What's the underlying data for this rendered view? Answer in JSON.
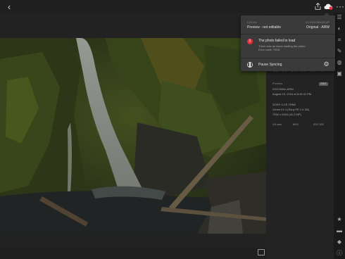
{
  "topbar": {
    "back_icon": "chevron-left-icon",
    "share_icon": "share-icon",
    "cloud_icon": "cloud-sync-icon",
    "more_icon": "more-icon"
  },
  "popover": {
    "local_caption": "LOCAL",
    "local_value": "Preview - not editable",
    "cloud_caption": "CLOUD BACKUP",
    "cloud_value": "Original - ARW",
    "error_title": "The photo failed to load",
    "error_body_line1": "There was an issue loading the photo.",
    "error_body_line2": "Error code: 7005.",
    "pause_label": "Pause Syncing",
    "colors": {
      "error": "#e0343c",
      "background": "#3a3a3a"
    }
  },
  "info": {
    "rating": 0,
    "rating_max": 5,
    "preview_label": "Preview",
    "edit_badge": "EDIT",
    "filename": "DSC05264.ARW",
    "date": "August 19, 2016 at 8:16:41 PM",
    "camera": "SONY ILCE-7RM2",
    "lens": "24mm f/1.4 (Sony FE 1.4 ZA)",
    "dimensions": "7952 x 5304 (42.2 MP)",
    "exif": [
      "1/4 sec",
      "f/8.0",
      "ISO 100"
    ]
  },
  "tools": [
    "adjust-icon",
    "presets-icon",
    "crop-icon",
    "brush-icon",
    "selective-icon",
    "healing-icon",
    "star-icon",
    "comment-icon",
    "tag-icon",
    "info-icon"
  ]
}
